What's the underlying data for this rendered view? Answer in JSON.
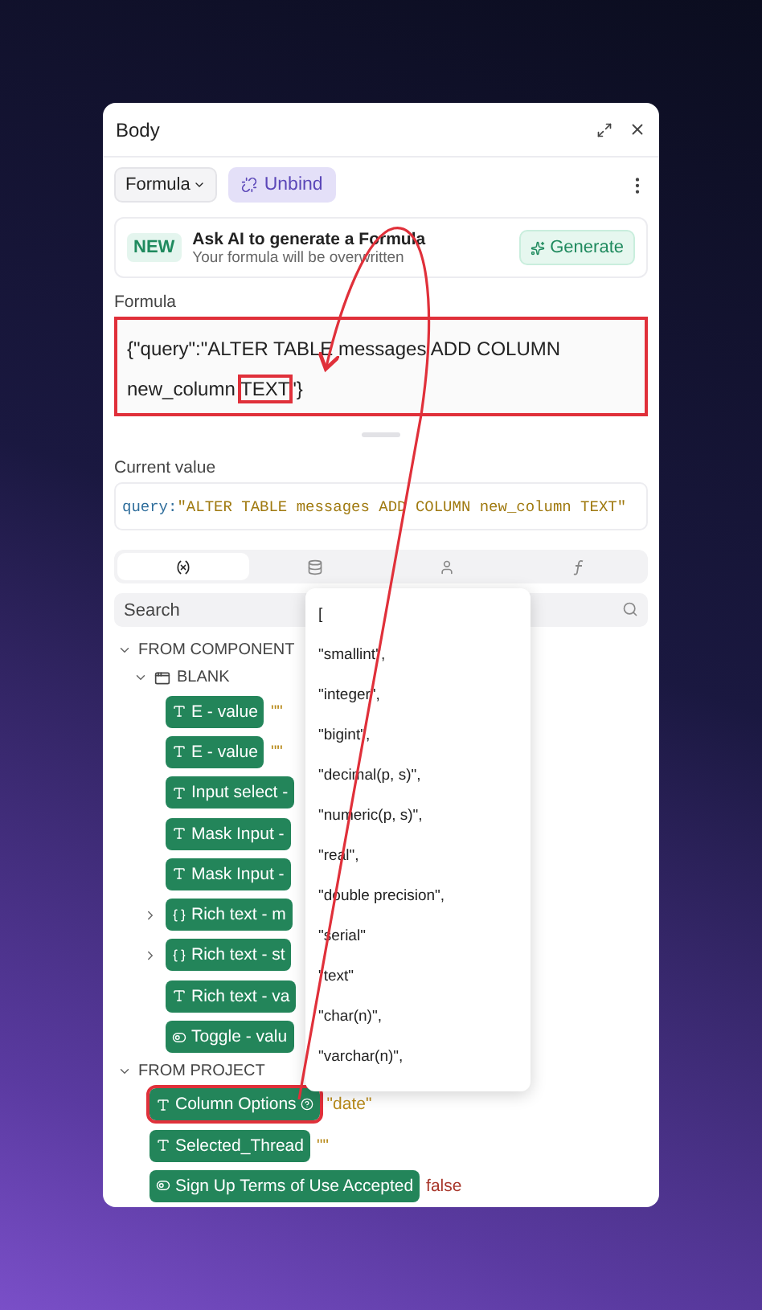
{
  "panel": {
    "title": "Body"
  },
  "toolbar": {
    "mode": "Formula",
    "unbind": "Unbind"
  },
  "ai_banner": {
    "badge": "NEW",
    "title": "Ask AI to generate a Formula",
    "subtitle": "Your formula will be overwritten",
    "button": "Generate"
  },
  "formula": {
    "label": "Formula",
    "highlighted": true,
    "lines": [
      [
        {
          "text": "{\"query\":\"ALTER TABLE messages ADD COLUMN",
          "highlighted": false
        }
      ],
      [
        {
          "text": "new_column ",
          "highlighted": false
        },
        {
          "text": "TEXT",
          "highlighted": true
        },
        {
          "text": "\"}",
          "highlighted": false
        }
      ]
    ]
  },
  "current_value": {
    "label": "Current value",
    "key": "query:",
    "value": "\"ALTER TABLE messages ADD COLUMN new_column TEXT\""
  },
  "tabs": [
    {
      "kind": "variables",
      "selected": true
    },
    {
      "kind": "database",
      "selected": false
    },
    {
      "kind": "user",
      "selected": false
    },
    {
      "kind": "function",
      "selected": false
    }
  ],
  "search": {
    "placeholder": "Search"
  },
  "tree": [
    {
      "label": "FROM COMPONENT",
      "expanded": true,
      "children": [
        {
          "label": "BLANK",
          "expanded": true,
          "children": [
            {
              "label": "E - value",
              "kind": "text",
              "value": "\"\"",
              "color": "#b88a1a"
            },
            {
              "label": "E - value",
              "kind": "text",
              "value": "\"\"",
              "color": "#b88a1a"
            },
            {
              "label": "Input select -",
              "kind": "text"
            },
            {
              "label": "Mask Input -",
              "kind": "text"
            },
            {
              "label": "Mask Input -",
              "kind": "text"
            },
            {
              "label": "Rich text - m",
              "kind": "object",
              "expanded": false
            },
            {
              "label": "Rich text - st",
              "kind": "object",
              "expanded": false
            },
            {
              "label": "Rich text - va",
              "kind": "text"
            },
            {
              "label": "Toggle - valu",
              "kind": "boolean"
            }
          ]
        }
      ]
    },
    {
      "label": "FROM PROJECT",
      "expanded": true,
      "items": [
        {
          "label": "Column Options",
          "kind": "text",
          "info": true,
          "highlighted": true,
          "value": "\"date\"",
          "color": "#b88a1a"
        },
        {
          "label": "Selected_Thread",
          "kind": "text",
          "value": "\"\"",
          "color": "#b88a1a"
        },
        {
          "label": "Sign Up Terms of Use Accepted",
          "kind": "boolean",
          "value": "false",
          "color": "#a8362a"
        }
      ]
    }
  ],
  "dropdown": {
    "items": [
      "[",
      "\"smallint\",",
      "\"integer\",",
      "\"bigint\",",
      "\"decimal(p, s)\",",
      "\"numeric(p, s)\",",
      "\"real\",",
      "\"double precision\",",
      "\"serial\"",
      "\"text\"",
      "\"char(n)\",",
      "\"varchar(n)\","
    ]
  }
}
